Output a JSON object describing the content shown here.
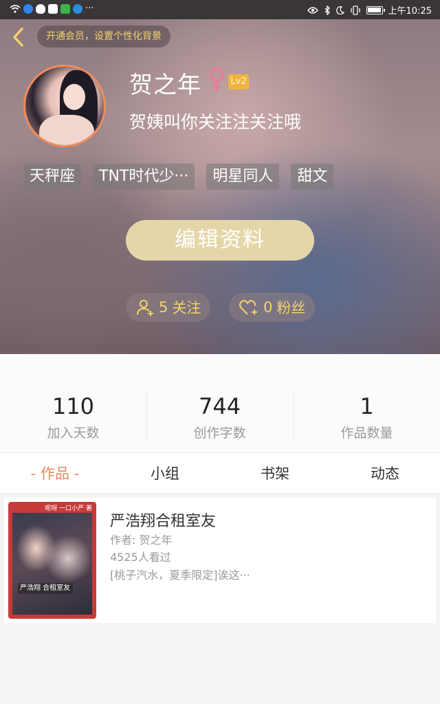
{
  "status_bar": {
    "time": "上午10:25",
    "more": "···"
  },
  "header": {
    "vip_text": "开通会员，设置个性化背景",
    "username": "贺之年",
    "level": "Lv2",
    "bio": "贺姨叫你关注注关注哦",
    "tags": [
      "天秤座",
      "TNT时代少···",
      "明星同人",
      "甜文"
    ],
    "edit_button": "编辑资料",
    "follow_count": "5",
    "follow_label": "关注",
    "fans_count": "0",
    "fans_label": "粉丝"
  },
  "stats": [
    {
      "value": "110",
      "label": "加入天数"
    },
    {
      "value": "744",
      "label": "创作字数"
    },
    {
      "value": "1",
      "label": "作品数量"
    }
  ],
  "tabs": [
    {
      "label": "- 作品 -",
      "active": true
    },
    {
      "label": "小组",
      "active": false
    },
    {
      "label": "书架",
      "active": false
    },
    {
      "label": "动态",
      "active": false
    }
  ],
  "works": [
    {
      "title": "严浩翔合租室友",
      "author_line": "作者: 贺之年",
      "views": "4525人看过",
      "summary": "[桃子汽水，夏季限定]诶这···",
      "cover_top_text": "呢呀 一口小严 著",
      "cover_title_text": "严浩翔  合租室友"
    }
  ],
  "colors": {
    "accent": "#e98a5b",
    "vip_text": "#f3d36a",
    "level_badge": "#f0b43e",
    "edit_button": "#e4d6a8",
    "gender_icon": "#e87b9a"
  }
}
